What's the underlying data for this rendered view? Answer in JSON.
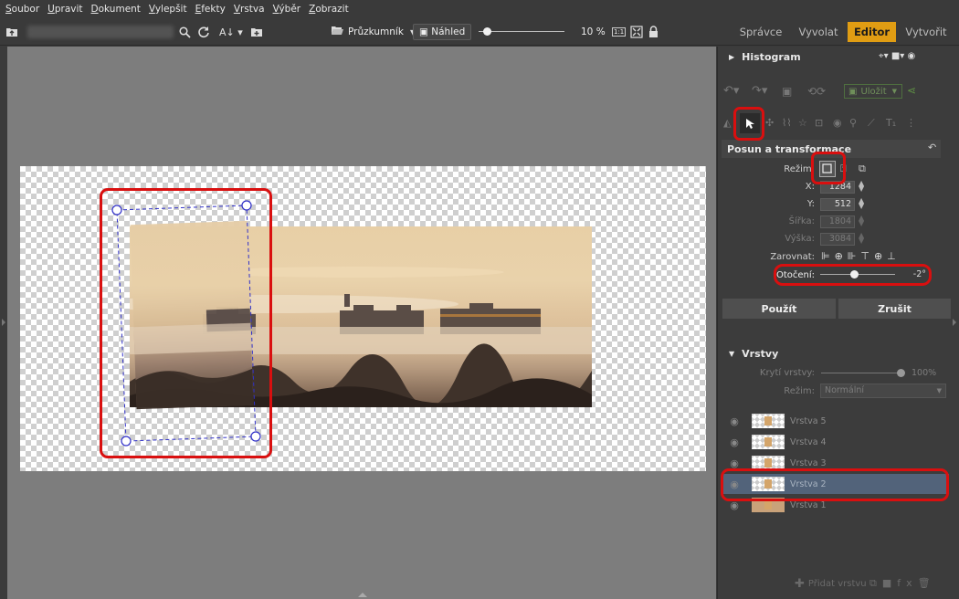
{
  "menu": [
    "Soubor",
    "Upravit",
    "Dokument",
    "Vylepšit",
    "Efekty",
    "Vrstva",
    "Výběr",
    "Zobrazit"
  ],
  "toolbar": {
    "explorer_label": "Průzkumník",
    "preview_label": "Náhled",
    "zoom": "10 %",
    "zoom_fraction": 0.1,
    "one_to_one": "1:1"
  },
  "tabs": [
    {
      "label": "Správce",
      "active": false
    },
    {
      "label": "Vyvolat",
      "active": false
    },
    {
      "label": "Editor",
      "active": true
    },
    {
      "label": "Vytvořit",
      "active": false
    }
  ],
  "panel": {
    "histogram_title": "Histogram",
    "save_label": "Uložit",
    "transform_title": "Posun a transformace",
    "mode_label": "Režim:",
    "x_label": "X:",
    "x_value": "1284",
    "y_label": "Y:",
    "y_value": "512",
    "width_label": "Šířka:",
    "width_value": "1804",
    "height_label": "Výška:",
    "height_value": "3084",
    "align_label": "Zarovnat:",
    "rotation_label": "Otočení:",
    "rotation_value": "-2°",
    "rotation_fraction": 0.45,
    "apply_label": "Použít",
    "cancel_label": "Zrušit",
    "layers_title": "Vrstvy",
    "opacity_label": "Krytí vrstvy:",
    "opacity_value": "100%",
    "blend_label": "Režim:",
    "blend_value": "Normální",
    "add_layer_label": "Přidat vrstvu",
    "layers": [
      {
        "name": "Vrstva 5",
        "selected": false
      },
      {
        "name": "Vrstva 4",
        "selected": false
      },
      {
        "name": "Vrstva 3",
        "selected": false
      },
      {
        "name": "Vrstva 2",
        "selected": true
      },
      {
        "name": "Vrstva 1",
        "selected": false
      }
    ]
  },
  "colors": {
    "accent": "#e09d13",
    "highlight": "#d90f0f",
    "selected_layer": "#52637a",
    "handle": "#3030c8"
  }
}
